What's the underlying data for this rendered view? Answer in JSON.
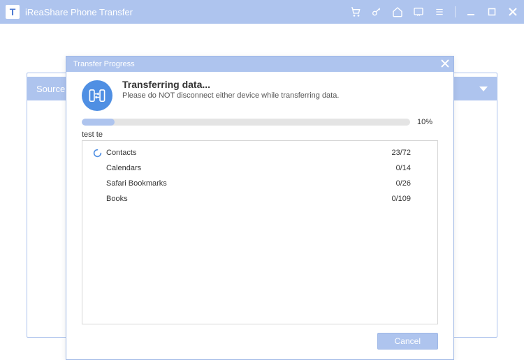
{
  "app": {
    "logo_letter": "T",
    "title": "iReaShare Phone Transfer"
  },
  "source_bar": {
    "label": "Source:"
  },
  "modal": {
    "header": "Transfer Progress",
    "title": "Transferring data...",
    "subtitle": "Please do NOT disconnect either device while transferring data.",
    "progress_percent": 10,
    "progress_label": "10%",
    "test_label": "test te",
    "items": [
      {
        "name": "Contacts",
        "count": "23/72",
        "spinning": true
      },
      {
        "name": "Calendars",
        "count": "0/14",
        "spinning": false
      },
      {
        "name": "Safari Bookmarks",
        "count": "0/26",
        "spinning": false
      },
      {
        "name": "Books",
        "count": "0/109",
        "spinning": false
      }
    ],
    "cancel_label": "Cancel"
  }
}
